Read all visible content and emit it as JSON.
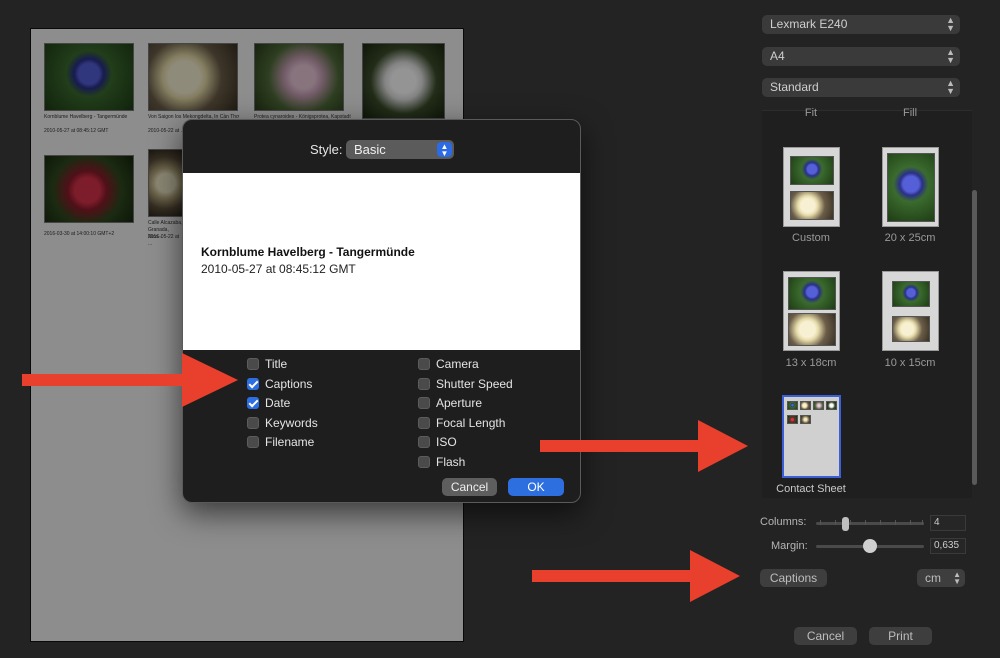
{
  "preview": {
    "thumbs": [
      {
        "caption": "Kornblume Havelberg - Tangermünde",
        "date": "2010-05-27 at 08:45:12 GMT"
      },
      {
        "caption": "Von Saigon los Mekongdelta, In Cần Thơ",
        "date": "2010-05-22 at ..."
      },
      {
        "caption": "Protea cynaroides - Königsprotea, Kapstadt",
        "date": ""
      },
      {
        "caption": "",
        "date": ""
      },
      {
        "caption": "",
        "date": "2016-03-30 at 14:00:10 GMT+2"
      },
      {
        "caption": "Calle Alcazaba, Granada, Nico...",
        "date": "2016-05-22 at ..."
      }
    ]
  },
  "dialog": {
    "style_label": "Style:",
    "style_value": "Basic",
    "preview_title": "Kornblume Havelberg - Tangermünde",
    "preview_date": "2010-05-27 at 08:45:12 GMT",
    "left_options": [
      {
        "label": "Title",
        "checked": false
      },
      {
        "label": "Captions",
        "checked": true
      },
      {
        "label": "Date",
        "checked": true
      },
      {
        "label": "Keywords",
        "checked": false
      },
      {
        "label": "Filename",
        "checked": false
      }
    ],
    "right_options": [
      {
        "label": "Camera",
        "checked": false
      },
      {
        "label": "Shutter Speed",
        "checked": false
      },
      {
        "label": "Aperture",
        "checked": false
      },
      {
        "label": "Focal Length",
        "checked": false
      },
      {
        "label": "ISO",
        "checked": false
      },
      {
        "label": "Flash",
        "checked": false
      }
    ],
    "cancel_label": "Cancel",
    "ok_label": "OK"
  },
  "panel": {
    "printer": "Lexmark E240",
    "paper": "A4",
    "quality": "Standard",
    "fit_label": "Fit",
    "fill_label": "Fill",
    "sizes": [
      {
        "label": "Custom"
      },
      {
        "label": "20 x 25cm"
      },
      {
        "label": "13 x 18cm"
      },
      {
        "label": "10 x 15cm"
      },
      {
        "label": "Contact Sheet"
      }
    ],
    "columns_label": "Columns:",
    "columns_value": "4",
    "margin_label": "Margin:",
    "margin_value": "0,635",
    "margin_level": 0.5,
    "captions_button": "Captions",
    "unit": "cm",
    "cancel_label": "Cancel",
    "print_label": "Print"
  },
  "colors": {
    "accent": "#2e6fe0",
    "arrow": "#e8402c",
    "background": "#232323"
  }
}
